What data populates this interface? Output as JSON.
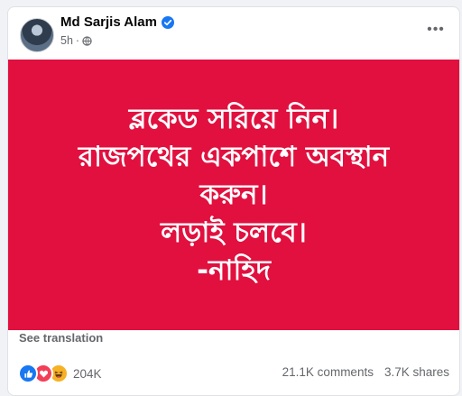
{
  "post": {
    "author_name": "Md Sarjis Alam",
    "verified": true,
    "time": "5h",
    "time_separator": "·",
    "privacy_icon": "globe-icon",
    "more_icon": "more-horizontal-icon",
    "more_label": "•••"
  },
  "banner": {
    "background_color": "#e1103f",
    "text_color": "#ffffff",
    "lines": [
      "ব্লকেড সরিয়ে নিন।",
      "রাজপথের একপাশে অবস্থান",
      "করুন।",
      "লড়াই চলবে।",
      "-নাহিদ"
    ]
  },
  "see_translation": "See translation",
  "engagement": {
    "reaction_icons": [
      "like-icon",
      "love-icon",
      "haha-icon"
    ],
    "reaction_count": "204K",
    "comments": "21.1K comments",
    "shares": "3.7K shares"
  },
  "colors": {
    "accent": "#1877f2",
    "secondary_text": "#65676b",
    "primary_text": "#050505"
  }
}
